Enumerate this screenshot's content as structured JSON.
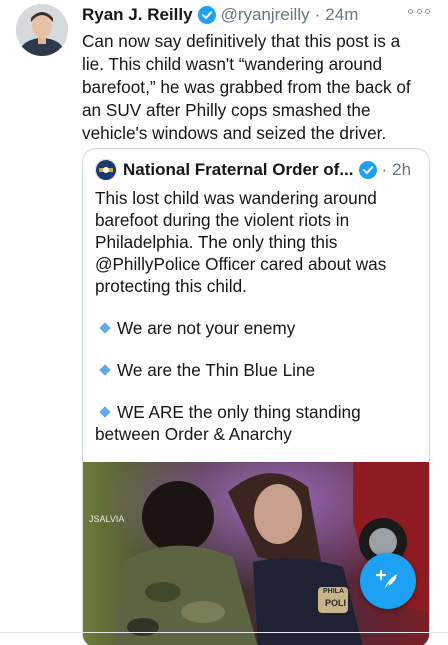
{
  "tweet": {
    "author_name": "Ryan J. Reilly",
    "handle": "@ryanjreilly",
    "separator": "·",
    "time": "24m",
    "text": "Can now say definitively that this post is a lie. This child wasn't “wandering around barefoot,” he was grabbed from the back of an SUV after Philly cops smashed the vehicle's windows and seized the driver."
  },
  "quoted_tweet": {
    "author_name": "National Fraternal Order of...",
    "separator": "·",
    "time": "2h",
    "paragraph": "This lost child was wandering around barefoot during the violent riots in Philadelphia. The only thing this @PhillyPolice Officer cared about was protecting this child.",
    "bullets": [
      "We are not your enemy",
      "We are the Thin Blue Line",
      "WE ARE the only thing standing between Order & Anarchy"
    ],
    "photo_overlay_texts": [
      "JSALVIA",
      "PHILA",
      "POLI"
    ]
  },
  "colors": {
    "accent": "#1da1f2",
    "text": "#14171a",
    "muted": "#657786",
    "border": "#ccd6dd"
  },
  "icons": {
    "verified": "verified-badge-icon",
    "more": "more-options-icon",
    "compose": "compose-tweet-icon"
  }
}
